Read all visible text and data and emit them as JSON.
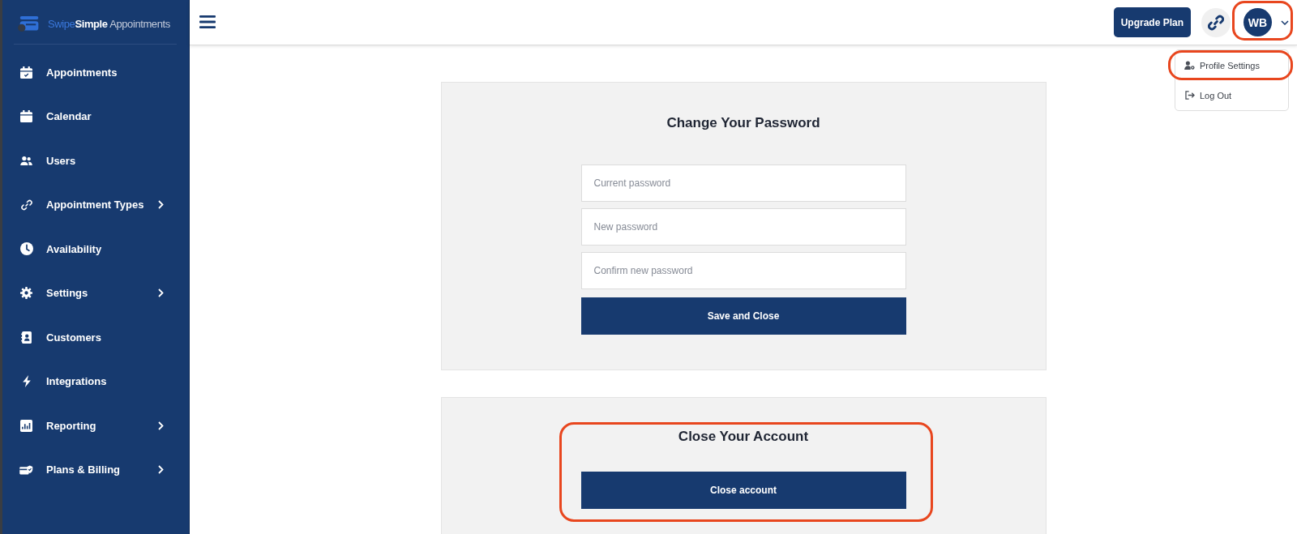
{
  "sidebar": {
    "logo": {
      "segments": [
        {
          "text": "Swipe",
          "kind": "accent"
        },
        {
          "text": "Simple",
          "kind": "strong"
        },
        {
          "text": " Appointments",
          "kind": "light"
        }
      ]
    },
    "items": [
      {
        "label": "Appointments",
        "expandable": false,
        "selected": false
      },
      {
        "label": "Calendar",
        "expandable": false,
        "selected": false
      },
      {
        "label": "Users",
        "expandable": false,
        "selected": false
      },
      {
        "label": "Appointment Types",
        "expandable": true,
        "selected": false
      },
      {
        "label": "Availability",
        "expandable": false,
        "selected": false
      },
      {
        "label": "Settings",
        "expandable": true,
        "selected": false
      },
      {
        "label": "Customers",
        "expandable": false,
        "selected": false
      },
      {
        "label": "Integrations",
        "expandable": false,
        "selected": false
      },
      {
        "label": "Reporting",
        "expandable": true,
        "selected": false
      },
      {
        "label": "Plans & Billing",
        "expandable": true,
        "selected": false
      }
    ]
  },
  "header": {
    "upgrade_button": "Upgrade Plan",
    "user_menu": {
      "initials": "WB",
      "expanded": true,
      "highlighted": true,
      "items": [
        {
          "label": "Profile Settings",
          "highlighted": true
        },
        {
          "label": "Log Out",
          "highlighted": false
        }
      ]
    }
  },
  "password_card": {
    "title": "Change Your Password",
    "fields": [
      {
        "placeholder": "Current password"
      },
      {
        "placeholder": "New password"
      },
      {
        "placeholder": "Confirm new password"
      }
    ],
    "submit_button": "Save and Close"
  },
  "close_account_card": {
    "title": "Close Your Account",
    "button": "Close account",
    "highlighted": true
  }
}
